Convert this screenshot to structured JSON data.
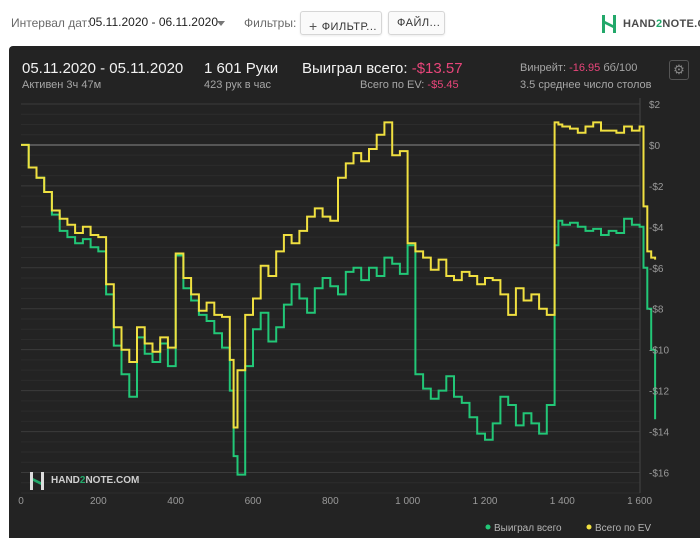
{
  "toolbar": {
    "date_interval_label": "Интервал дат:",
    "date_range_value": "05.11.2020 - 06.11.2020",
    "filters_label": "Фильтры:",
    "filter_button_label": "ФИЛЬТР...",
    "file_button_label": "ФАЙЛ..."
  },
  "logo": {
    "prefix": "HAND",
    "two": "2",
    "suffix": "NOTE.COM",
    "color": "#22a86a"
  },
  "summary": {
    "date_range": "05.11.2020 - 05.11.2020",
    "active_time": "Активен 3ч 47м",
    "hands": "1 601 Руки",
    "hands_per_hour": "423 рук в час",
    "won_total_label": "Выиграл всего:",
    "won_total_value": "-$13.57",
    "ev_total_label": "Всего по EV:",
    "ev_total_value": "-$5.45",
    "winrate_label": "Винрейт:",
    "winrate_value": "-16.95",
    "winrate_suffix": "бб/100",
    "avg_tables": "3.5 среднее число столов"
  },
  "watermark": {
    "prefix": "HAND",
    "two": "2",
    "suffix": "NOTE.COM"
  },
  "chart_data": {
    "type": "line",
    "xlim": [
      0,
      1601
    ],
    "ylim": [
      -17,
      2
    ],
    "x_ticks": [
      0,
      200,
      400,
      600,
      800,
      1000,
      1200,
      1400,
      1600
    ],
    "x_tick_labels": [
      "0",
      "200",
      "400",
      "600",
      "800",
      "1 000",
      "1 200",
      "1 400",
      "1 600"
    ],
    "y_ticks": [
      2,
      0,
      -2,
      -4,
      -6,
      -8,
      -10,
      -12,
      -14,
      -16
    ],
    "y_tick_labels": [
      "$2",
      "$0",
      "-$2",
      "-$4",
      "-$6",
      "-$8",
      "-$10",
      "-$12",
      "-$14",
      "-$16"
    ],
    "grid": true,
    "zero_line": true,
    "legend_position": "bottom-right",
    "series": [
      {
        "name": "Выиграл всего",
        "color": "#22c777",
        "x": [
          0,
          20,
          40,
          60,
          80,
          100,
          120,
          140,
          160,
          180,
          200,
          220,
          240,
          260,
          280,
          300,
          320,
          340,
          360,
          380,
          400,
          420,
          440,
          460,
          480,
          500,
          520,
          540,
          550,
          560,
          580,
          600,
          620,
          640,
          660,
          680,
          700,
          720,
          740,
          760,
          780,
          800,
          820,
          840,
          860,
          880,
          900,
          920,
          940,
          960,
          980,
          1000,
          1020,
          1040,
          1060,
          1080,
          1100,
          1120,
          1140,
          1160,
          1180,
          1200,
          1220,
          1240,
          1260,
          1280,
          1300,
          1320,
          1340,
          1360,
          1380,
          1390,
          1400,
          1420,
          1440,
          1460,
          1480,
          1500,
          1520,
          1540,
          1560,
          1580,
          1600,
          1610,
          1620,
          1630,
          1640
        ],
        "y": [
          0,
          -1.1,
          -1.6,
          -2.3,
          -3.4,
          -4.2,
          -4.5,
          -4.8,
          -4.6,
          -5.0,
          -5.2,
          -7.3,
          -9.8,
          -11.2,
          -12.3,
          -9.4,
          -10.2,
          -10.6,
          -9.7,
          -10.8,
          -5.4,
          -7.0,
          -7.6,
          -8.3,
          -8.6,
          -9.2,
          -9.9,
          -12.0,
          -15.2,
          -16.1,
          -10.8,
          -9.0,
          -8.2,
          -9.6,
          -8.9,
          -7.8,
          -6.8,
          -7.5,
          -8.2,
          -7.0,
          -6.5,
          -6.9,
          -7.3,
          -6.2,
          -6.0,
          -6.6,
          -6.0,
          -6.4,
          -5.5,
          -5.8,
          -6.3,
          -4.9,
          -11.2,
          -11.9,
          -12.4,
          -12.0,
          -11.3,
          -12.3,
          -12.6,
          -13.3,
          -14.1,
          -14.4,
          -13.6,
          -12.3,
          -12.7,
          -13.7,
          -13.1,
          -13.6,
          -14.1,
          -12.7,
          -4.9,
          -3.7,
          -3.9,
          -3.8,
          -4.0,
          -4.2,
          -4.1,
          -4.4,
          -4.2,
          -4.3,
          -3.6,
          -3.9,
          -4.0,
          -6.0,
          -8.0,
          -10.0,
          -13.4
        ]
      },
      {
        "name": "Всего по EV",
        "color": "#f0e040",
        "x": [
          0,
          20,
          40,
          60,
          80,
          100,
          120,
          140,
          160,
          180,
          200,
          220,
          240,
          260,
          280,
          300,
          320,
          340,
          360,
          380,
          400,
          420,
          440,
          460,
          480,
          500,
          520,
          540,
          550,
          560,
          580,
          600,
          620,
          640,
          660,
          680,
          700,
          720,
          740,
          760,
          780,
          800,
          820,
          840,
          860,
          880,
          900,
          920,
          940,
          960,
          980,
          1000,
          1020,
          1040,
          1060,
          1080,
          1100,
          1120,
          1140,
          1160,
          1180,
          1200,
          1220,
          1240,
          1260,
          1280,
          1300,
          1320,
          1340,
          1360,
          1380,
          1390,
          1400,
          1420,
          1440,
          1460,
          1480,
          1500,
          1520,
          1540,
          1560,
          1580,
          1600,
          1610,
          1620,
          1630,
          1640
        ],
        "y": [
          0,
          -1.1,
          -1.6,
          -2.3,
          -3.2,
          -3.6,
          -3.9,
          -4.3,
          -4.0,
          -4.4,
          -4.5,
          -6.8,
          -8.9,
          -10.0,
          -10.6,
          -8.9,
          -9.7,
          -10.1,
          -9.4,
          -9.9,
          -5.3,
          -6.5,
          -7.3,
          -8.1,
          -7.7,
          -8.3,
          -8.4,
          -10.5,
          -13.8,
          -11.0,
          -8.3,
          -7.5,
          -5.9,
          -6.4,
          -5.2,
          -4.4,
          -4.8,
          -4.2,
          -3.5,
          -3.1,
          -3.5,
          -3.7,
          -1.6,
          -0.9,
          -0.4,
          -0.8,
          -0.2,
          0.5,
          1.1,
          -0.5,
          -0.3,
          -4.8,
          -5.2,
          -5.5,
          -6.1,
          -5.6,
          -6.4,
          -6.6,
          -6.2,
          -6.4,
          -6.8,
          -6.5,
          -6.6,
          -7.3,
          -8.3,
          -7.0,
          -7.6,
          -7.3,
          -8.0,
          -8.3,
          1.1,
          1.0,
          0.9,
          0.8,
          0.6,
          0.9,
          1.1,
          0.7,
          0.7,
          0.6,
          0.9,
          0.7,
          0.9,
          -3.0,
          -5.2,
          -5.5,
          -5.6
        ]
      }
    ]
  }
}
